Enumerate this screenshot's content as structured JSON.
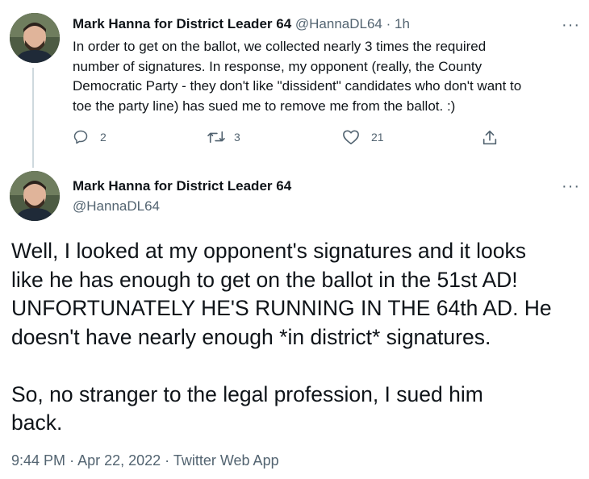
{
  "tweet1": {
    "author_name": "Mark Hanna for District Leader 64",
    "handle": "@HannaDL64",
    "separator": "·",
    "time": "1h",
    "text_lines": [
      "In order to get on the ballot, we collected nearly 3 times the required",
      "number of signatures. In response, my opponent (really, the County",
      "Democratic Party - they don't like \"dissident\" candidates who don't want to",
      "toe the party line) has sued me to remove me from the ballot. :)"
    ],
    "replies": "2",
    "retweets": "3",
    "likes": "21",
    "more": "···"
  },
  "tweet2": {
    "author_name": "Mark Hanna for District Leader 64",
    "handle": "@HannaDL64",
    "more": "···",
    "text_lines": [
      "Well, I looked at my opponent's signatures and it looks",
      "like he has enough to get on the ballot in the 51st AD!",
      "UNFORTUNATELY HE'S RUNNING IN THE 64th AD. He",
      "doesn't have nearly enough *in district* signatures."
    ],
    "text_lines_2": [
      "So, no stranger to the legal profession, I sued him",
      "back."
    ],
    "time": "9:44 PM",
    "date": "Apr 22, 2022",
    "source": "Twitter Web App",
    "separator": "·"
  },
  "icons": {
    "reply": "reply-icon",
    "retweet": "retweet-icon",
    "like": "heart-icon",
    "share": "share-icon",
    "more": "more-icon"
  }
}
